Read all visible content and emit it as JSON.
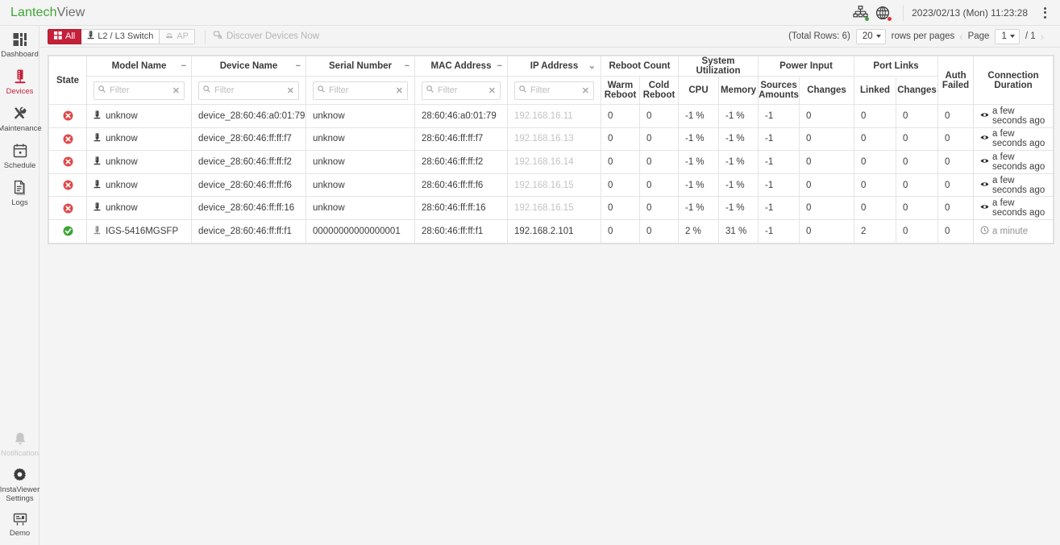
{
  "titlebar": {
    "app_name_part1": "Lantech",
    "app_name_part2": "View",
    "brand_color": "#3fa535",
    "network_icon": "sitemap-icon",
    "network_status_color": "#3fa535",
    "globe_icon": "globe-icon",
    "globe_status_color": "#e03131",
    "datetime": "2023/02/13 (Mon) 11:23:28",
    "overflow_menu": "kebab-menu-icon"
  },
  "sidebar": {
    "items": [
      {
        "label": "Dashboard",
        "icon": "dashboard-icon",
        "active": false
      },
      {
        "label": "Devices",
        "icon": "devices-icon",
        "active": true
      },
      {
        "label": "Maintenance",
        "icon": "maintenance-icon",
        "active": false
      },
      {
        "label": "Schedule",
        "icon": "schedule-icon",
        "active": false
      },
      {
        "label": "Logs",
        "icon": "logs-icon",
        "active": false
      }
    ],
    "bottom_items": [
      {
        "label": "Notification",
        "icon": "bell-icon",
        "disabled": true
      },
      {
        "label_line1": "InstaViewer",
        "label_line2": "Settings",
        "icon": "gear-icon",
        "disabled": false
      },
      {
        "label": "Demo",
        "icon": "demo-icon",
        "disabled": false
      }
    ],
    "active_color": "#c5203a"
  },
  "toolbar": {
    "filters": [
      {
        "label": "All",
        "icon": "grid-icon",
        "state": "active"
      },
      {
        "label": "L2 / L3 Switch",
        "icon": "switch-icon",
        "state": "normal"
      },
      {
        "label": "AP",
        "icon": "ap-icon",
        "state": "disabled"
      }
    ],
    "discover_label": "Discover Devices Now",
    "discover_icon": "discover-icon",
    "active_color": "#c5203a"
  },
  "pager": {
    "total_rows_label": "(Total Rows: 6)",
    "rows_per_page_value": "20",
    "rows_per_page_label": "rows per pages",
    "prev_arrow": "‹",
    "page_label": "Page",
    "page_value": "1",
    "page_separator": "/ 1",
    "next_arrow": "›"
  },
  "table": {
    "group_headers": [
      {
        "label": "State",
        "rowspan": 2
      },
      {
        "label": "Model Name",
        "sort": "−"
      },
      {
        "label": "Device Name",
        "sort": "−"
      },
      {
        "label": "Serial Number",
        "sort": "−"
      },
      {
        "label": "MAC Address",
        "sort": "−"
      },
      {
        "label": "IP Address",
        "sort": "⌄"
      },
      {
        "label": "Reboot Count"
      },
      {
        "label": "System Utilization"
      },
      {
        "label": "Power Input"
      },
      {
        "label": "Port Links"
      },
      {
        "label": "Auth Failed",
        "rowspan": 2
      },
      {
        "label": "Connection Duration",
        "rowspan": 2
      }
    ],
    "filter_placeholder": "Filter",
    "filter_icon": "search-icon",
    "filter_clear_icon": "clear-icon",
    "sub_headers": [
      "Warm Reboot",
      "Cold Reboot",
      "CPU",
      "Memory",
      "Sources Amounts",
      "Changes",
      "Linked",
      "Changes"
    ],
    "rows": [
      {
        "state": "error",
        "model_icon": "device-unknown-icon",
        "model": "unknow",
        "device_name": "device_28:60:46:a0:01:79",
        "serial": "unknow",
        "mac": "28:60:46:a0:01:79",
        "ip": "192.168.16.11",
        "ip_dim": true,
        "warm_reboot": "0",
        "cold_reboot": "0",
        "cpu": "-1 %",
        "memory": "-1 %",
        "power_sources": "-1",
        "power_changes": "0",
        "port_linked": "0",
        "port_changes": "0",
        "auth_failed": "0",
        "duration": "a few seconds ago",
        "duration_icon": "eye-icon",
        "duration_muted": false
      },
      {
        "state": "error",
        "model_icon": "device-unknown-icon",
        "model": "unknow",
        "device_name": "device_28:60:46:ff:ff:f7",
        "serial": "unknow",
        "mac": "28:60:46:ff:ff:f7",
        "ip": "192.168.16.13",
        "ip_dim": true,
        "warm_reboot": "0",
        "cold_reboot": "0",
        "cpu": "-1 %",
        "memory": "-1 %",
        "power_sources": "-1",
        "power_changes": "0",
        "port_linked": "0",
        "port_changes": "0",
        "auth_failed": "0",
        "duration": "a few seconds ago",
        "duration_icon": "eye-icon",
        "duration_muted": false
      },
      {
        "state": "error",
        "model_icon": "device-unknown-icon",
        "model": "unknow",
        "device_name": "device_28:60:46:ff:ff:f2",
        "serial": "unknow",
        "mac": "28:60:46:ff:ff:f2",
        "ip": "192.168.16.14",
        "ip_dim": true,
        "warm_reboot": "0",
        "cold_reboot": "0",
        "cpu": "-1 %",
        "memory": "-1 %",
        "power_sources": "-1",
        "power_changes": "0",
        "port_linked": "0",
        "port_changes": "0",
        "auth_failed": "0",
        "duration": "a few seconds ago",
        "duration_icon": "eye-icon",
        "duration_muted": false
      },
      {
        "state": "error",
        "model_icon": "device-unknown-icon",
        "model": "unknow",
        "device_name": "device_28:60:46:ff:ff:f6",
        "serial": "unknow",
        "mac": "28:60:46:ff:ff:f6",
        "ip": "192.168.16.15",
        "ip_dim": true,
        "warm_reboot": "0",
        "cold_reboot": "0",
        "cpu": "-1 %",
        "memory": "-1 %",
        "power_sources": "-1",
        "power_changes": "0",
        "port_linked": "0",
        "port_changes": "0",
        "auth_failed": "0",
        "duration": "a few seconds ago",
        "duration_icon": "eye-icon",
        "duration_muted": false
      },
      {
        "state": "error",
        "model_icon": "device-unknown-icon",
        "model": "unknow",
        "device_name": "device_28:60:46:ff:ff:16",
        "serial": "unknow",
        "mac": "28:60:46:ff:ff:16",
        "ip": "192.168.16.15",
        "ip_dim": true,
        "warm_reboot": "0",
        "cold_reboot": "0",
        "cpu": "-1 %",
        "memory": "-1 %",
        "power_sources": "-1",
        "power_changes": "0",
        "port_linked": "0",
        "port_changes": "0",
        "auth_failed": "0",
        "duration": "a few seconds ago",
        "duration_icon": "eye-icon",
        "duration_muted": false
      },
      {
        "state": "ok",
        "model_icon": "switch-device-icon",
        "model": "IGS-5416MGSFP",
        "device_name": "device_28:60:46:ff:ff:f1",
        "serial": "00000000000000001",
        "mac": "28:60:46:ff:ff:f1",
        "ip": "192.168.2.101",
        "ip_dim": false,
        "warm_reboot": "0",
        "cold_reboot": "0",
        "cpu": "2 %",
        "memory": "31 %",
        "power_sources": "-1",
        "power_changes": "0",
        "port_linked": "2",
        "port_changes": "0",
        "auth_failed": "0",
        "duration": "a minute",
        "duration_icon": "clock-icon",
        "duration_muted": true
      }
    ],
    "state_colors": {
      "error": "#e04a4a",
      "ok": "#3fa535"
    }
  }
}
